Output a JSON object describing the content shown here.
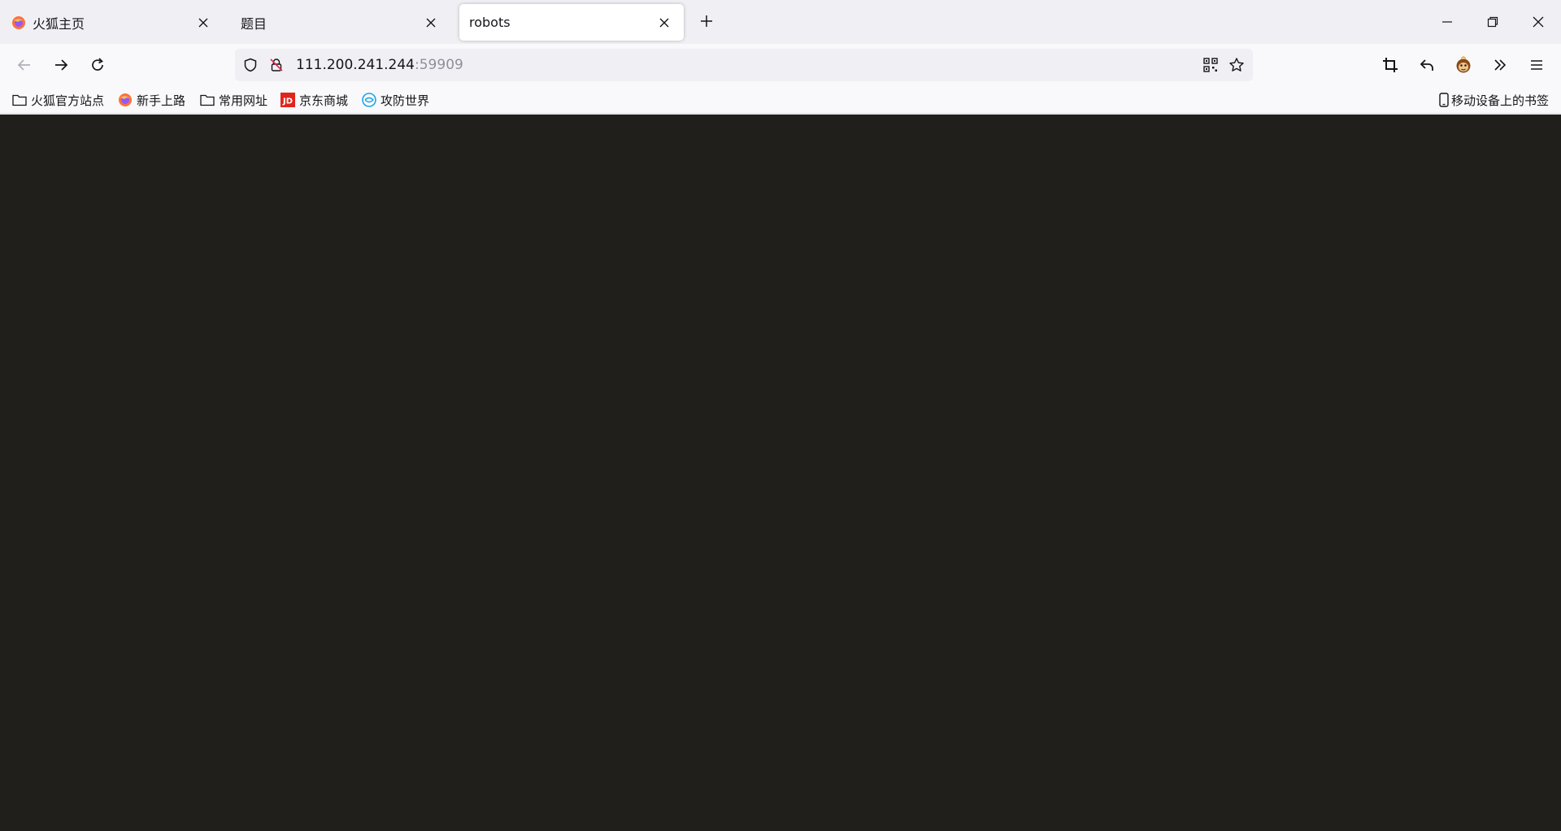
{
  "tabs": [
    {
      "title": "火狐主页",
      "icon": "firefox-icon",
      "active": false
    },
    {
      "title": "题目",
      "icon": "",
      "active": false
    },
    {
      "title": "robots",
      "icon": "",
      "active": true
    }
  ],
  "window_controls": [
    "minimize-icon",
    "restore-icon",
    "close-icon"
  ],
  "navbar": {
    "url_host": "111.200.241.244",
    "url_port": ":59909"
  },
  "bookmarks": [
    {
      "label": "火狐官方站点",
      "icon": "folder-icon"
    },
    {
      "label": "新手上路",
      "icon": "firefox-icon"
    },
    {
      "label": "常用网址",
      "icon": "folder-icon"
    },
    {
      "label": "京东商城",
      "icon": "jd-icon"
    },
    {
      "label": "攻防世界",
      "icon": "adworld-icon"
    }
  ],
  "mobile_bookmarks": {
    "label": "移动设备上的书签",
    "icon": "mobile-icon"
  },
  "colors": {
    "content_bg": "#201f1c",
    "chrome_bg": "#f0f0f4",
    "toolbar_bg": "#f9f9fb"
  }
}
